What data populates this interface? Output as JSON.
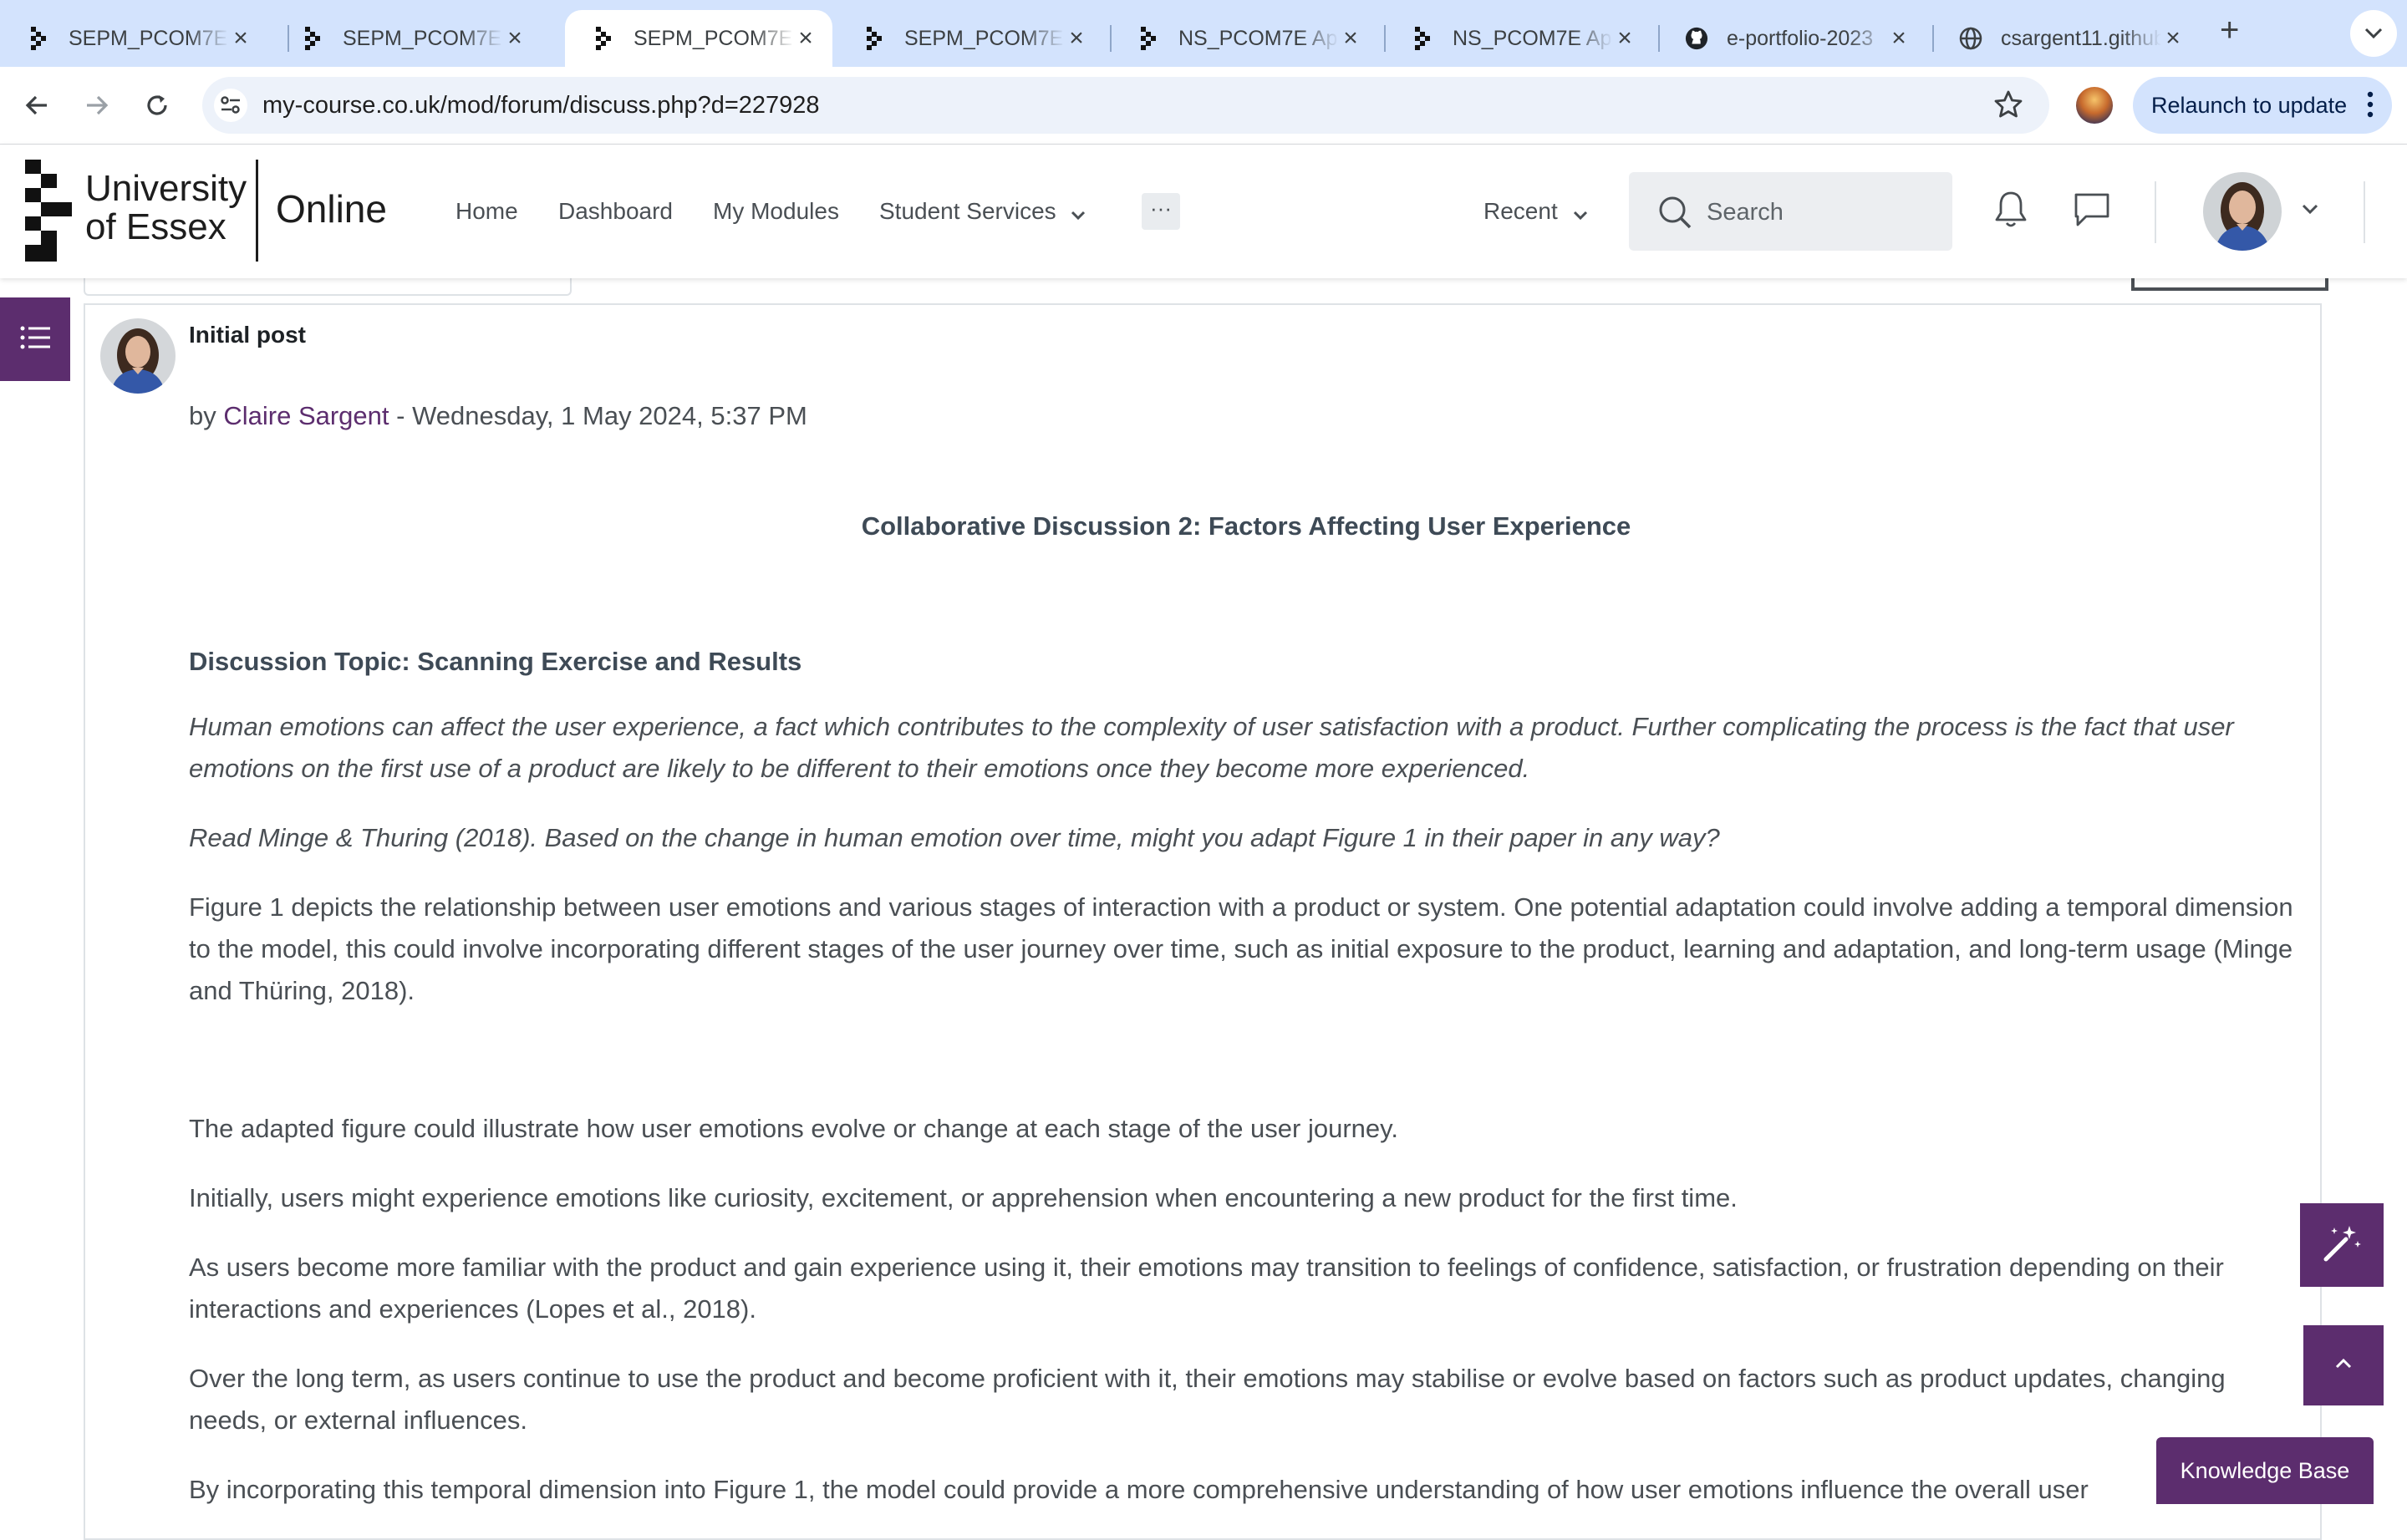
{
  "browser": {
    "tabs": [
      {
        "title": "SEPM_PCOM7E",
        "icon": "essex-chequer-icon",
        "active": false
      },
      {
        "title": "SEPM_PCOM7E",
        "icon": "essex-chequer-icon",
        "active": false
      },
      {
        "title": "SEPM_PCOM7E",
        "icon": "essex-chequer-icon",
        "active": true
      },
      {
        "title": "SEPM_PCOM7E",
        "icon": "essex-chequer-icon",
        "active": false
      },
      {
        "title": "NS_PCOM7E Ap",
        "icon": "essex-chequer-icon",
        "active": false
      },
      {
        "title": "NS_PCOM7E Ap",
        "icon": "essex-chequer-icon",
        "active": false
      },
      {
        "title": "e-portfolio-2023",
        "icon": "github-icon",
        "active": false
      },
      {
        "title": "csargent11.github",
        "icon": "globe-icon",
        "active": false
      }
    ],
    "url": "my-course.co.uk/mod/forum/discuss.php?d=227928",
    "relaunch_label": "Relaunch to update"
  },
  "site": {
    "logo_line1": "University",
    "logo_line2": "of Essex",
    "logo_online": "Online",
    "nav": {
      "home": "Home",
      "dashboard": "Dashboard",
      "my_modules": "My Modules",
      "student_services": "Student Services",
      "more": "···",
      "recent": "Recent"
    },
    "search_placeholder": "Search"
  },
  "post": {
    "subject": "Initial post",
    "by_prefix": "by ",
    "author": "Claire Sargent",
    "date_sep": " - ",
    "date": "Wednesday, 1 May 2024, 5:37 PM",
    "title": "Collaborative Discussion 2: Factors Affecting User Experience",
    "topic": "Discussion Topic: Scanning Exercise and Results",
    "prompt1": "Human emotions can affect the user experience, a fact which contributes to the complexity of user satisfaction with a product. Further complicating the process is the fact that user emotions on the first use of a product are likely to be different to their emotions once they become more experienced.",
    "prompt2": "Read Minge & Thuring (2018). Based on the change in human emotion over time, might you adapt Figure 1 in their paper in any way?",
    "para1": "Figure 1 depicts the relationship between user emotions and various stages of interaction with a product or system. One potential adaptation could involve adding a temporal dimension to the model, this could involve incorporating different stages of the user journey over time, such as initial exposure to the product, learning and adaptation, and long-term usage (Minge and Thüring, 2018).",
    "para2": "The adapted figure could illustrate how user emotions evolve or change at each stage of the user journey.",
    "para3": "Initially, users might experience emotions like curiosity, excitement, or apprehension when encountering a new product for the first time.",
    "para4": "As users become more familiar with the product and gain experience using it, their emotions may transition to feelings of confidence, satisfaction, or frustration depending on their interactions and experiences (Lopes et al., 2018).",
    "para5": "Over the long term, as users continue to use the product and become proficient with it, their emotions may stabilise or evolve based on factors such as product updates, changing needs, or external influences.",
    "para6": "By incorporating this temporal dimension into Figure 1, the model could provide a more comprehensive understanding of how user emotions influence the overall user"
  },
  "widgets": {
    "knowledge_base": "Knowledge Base"
  },
  "colors": {
    "brand_purple": "#5c2d6e",
    "tabstrip": "#d3e3fd"
  }
}
